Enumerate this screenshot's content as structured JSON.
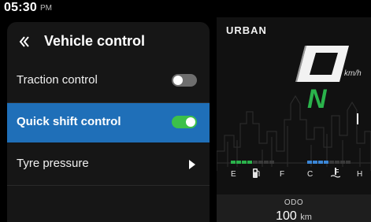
{
  "status": {
    "time": "05:30",
    "ampm": "PM"
  },
  "panel": {
    "title": "Vehicle control",
    "items": [
      {
        "label": "Traction control",
        "control": "toggle",
        "state": "off"
      },
      {
        "label": "Quick shift control",
        "control": "toggle",
        "state": "on",
        "selected": true
      },
      {
        "label": "Tyre pressure",
        "control": "submenu"
      }
    ]
  },
  "dashboard": {
    "ride_mode": "URBAN",
    "speed_unit": "km/h",
    "gear": "N",
    "fuel": {
      "empty_label": "E",
      "full_label": "F",
      "icon": "fuel-pump-icon",
      "level_segments": 4,
      "total_segments": 8,
      "color": "#2ab34b"
    },
    "temperature": {
      "cold_label": "C",
      "hot_label": "H",
      "icon": "coolant-temp-icon",
      "level_segments": 4,
      "total_segments": 8,
      "color": "#3b86d6"
    },
    "odo": {
      "label": "ODO",
      "value": "100",
      "unit": "km"
    }
  },
  "colors": {
    "selected_row": "#1f6fb8",
    "toggle_on": "#3cc04a",
    "toggle_off": "#6e6e6e",
    "gear": "#2ab34b"
  }
}
